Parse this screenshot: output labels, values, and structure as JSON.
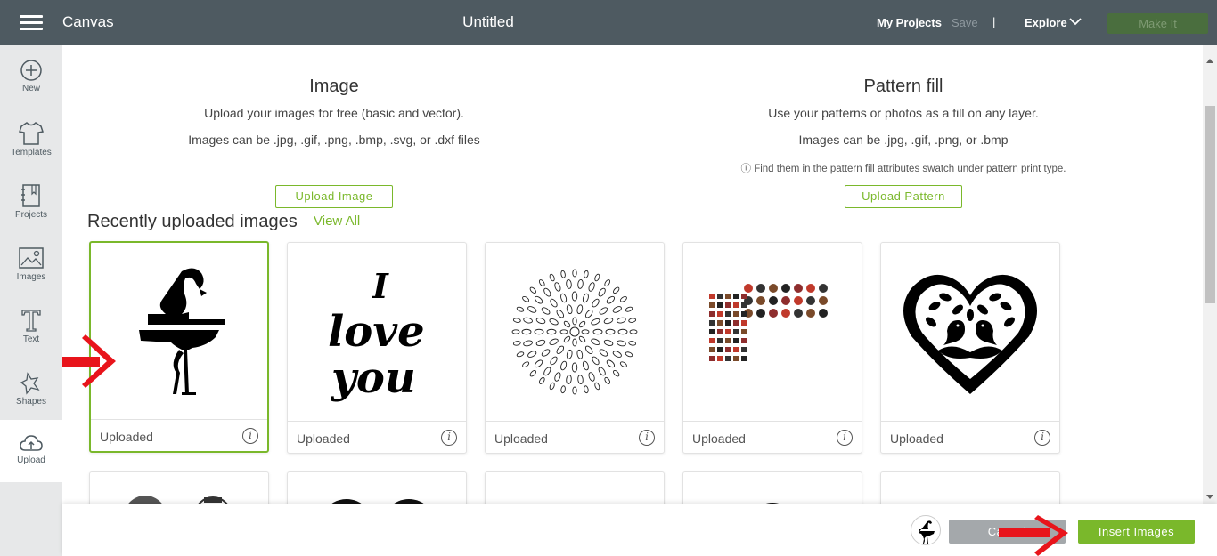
{
  "topbar": {
    "app_title": "Canvas",
    "doc_title": "Untitled",
    "my_projects": "My Projects",
    "save": "Save",
    "separator": "|",
    "explore": "Explore",
    "make_it": "Make It"
  },
  "sidebar": {
    "items": [
      {
        "label": "New",
        "icon": "plus-circle-icon"
      },
      {
        "label": "Templates",
        "icon": "tshirt-icon"
      },
      {
        "label": "Projects",
        "icon": "notebook-icon"
      },
      {
        "label": "Images",
        "icon": "image-icon"
      },
      {
        "label": "Text",
        "icon": "text-icon"
      },
      {
        "label": "Shapes",
        "icon": "shapes-icon"
      },
      {
        "label": "Upload",
        "icon": "cloud-upload-icon",
        "active": true
      }
    ]
  },
  "image_section": {
    "title": "Image",
    "line1": "Upload your images for free (basic and vector).",
    "line2": "Images can be .jpg, .gif, .png, .bmp, .svg, or .dxf files",
    "button": "Upload Image"
  },
  "pattern_section": {
    "title": "Pattern fill",
    "line1": "Use your patterns or photos as a fill on any layer.",
    "line2": "Images can be .jpg, .gif, .png, or .bmp",
    "note": "ⓘ Find them in the pattern fill attributes swatch under pattern print type.",
    "button": "Upload Pattern"
  },
  "recent": {
    "title": "Recently uploaded images",
    "view_all": "View All",
    "cards": [
      {
        "caption": "Uploaded",
        "image": "flamingo",
        "selected": true
      },
      {
        "caption": "Uploaded",
        "image": "i-love-you-lettering",
        "selected": false
      },
      {
        "caption": "Uploaded",
        "image": "floral-mandala",
        "selected": false
      },
      {
        "caption": "Uploaded",
        "image": "badge-collection",
        "selected": false
      },
      {
        "caption": "Uploaded",
        "image": "bird-heart",
        "selected": false
      }
    ],
    "lettering": [
      "I",
      "love",
      "you"
    ]
  },
  "bottom": {
    "cancel": "Cancel",
    "insert": "Insert Images"
  },
  "colors": {
    "accent": "#7ab82b",
    "topbar": "#4e5a61",
    "sidebar": "#e7e8e9",
    "arrow": "#e8141b"
  }
}
